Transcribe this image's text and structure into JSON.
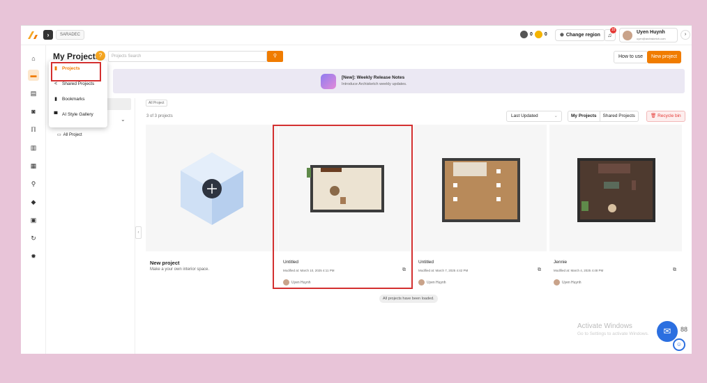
{
  "topbar": {
    "team": "SARADEC",
    "credits_a": "0",
    "credits_b": "0",
    "region": "Change region",
    "notification_count": "10",
    "user_name": "Uyen Huynh",
    "user_email": "uyen@archisketch.com"
  },
  "rail": [
    "home-icon",
    "folder-icon",
    "image-icon",
    "camera-icon",
    "chair-icon",
    "sofa-icon",
    "calendar-icon",
    "map-pin-icon",
    "box-icon",
    "book-icon",
    "refresh-icon",
    "settings-icon"
  ],
  "header": {
    "title": "My Projects",
    "help": "?",
    "search_placeholder": "Projects Search",
    "how_to_use": "How to use",
    "new_project": "New project"
  },
  "banner": {
    "title": "[New]: Weekly Release Notes",
    "subtitle": "Introduce Archisketch weekly updates."
  },
  "dropdown": [
    {
      "label": "Projects",
      "icon": "document-icon",
      "active": true
    },
    {
      "label": "Shared Projects",
      "icon": "share-icon",
      "active": false
    },
    {
      "label": "Bookmarks",
      "icon": "bookmark-icon",
      "active": false
    },
    {
      "label": "AI Style Gallery",
      "icon": "gallery-icon",
      "active": false
    }
  ],
  "folders": {
    "all_project": "All Project"
  },
  "list": {
    "crumb": "All Project",
    "count": "3 of 3 projects",
    "sort": "Last Updated",
    "my_projects": "My Projects",
    "shared_projects": "Shared Projects",
    "recycle_bin": "Recycle bin",
    "loaded": "All projects have been loaded."
  },
  "new_card": {
    "title": "New project",
    "subtitle": "Make a your own interior space."
  },
  "projects": [
    {
      "title": "Untitled",
      "modified": "Modified at: March 10, 2025 4:11 PM",
      "owner": "Uyen Huynh",
      "floor": "#ece3d2"
    },
    {
      "title": "Untitled",
      "modified": "Modified at: March 7, 2025 4:42 PM",
      "owner": "Uyen Huynh",
      "floor": "#b88a5a"
    },
    {
      "title": "Jennie",
      "modified": "Modified at: March 4, 2025 4:48 PM",
      "owner": "Uyen Huynh",
      "floor": "#4e3a2f"
    }
  ],
  "watermark": {
    "line1": "Activate Windows",
    "line2": "Go to Settings to activate Windows."
  },
  "colors": {
    "accent": "#f07c00",
    "highlight": "#d32f2f"
  }
}
